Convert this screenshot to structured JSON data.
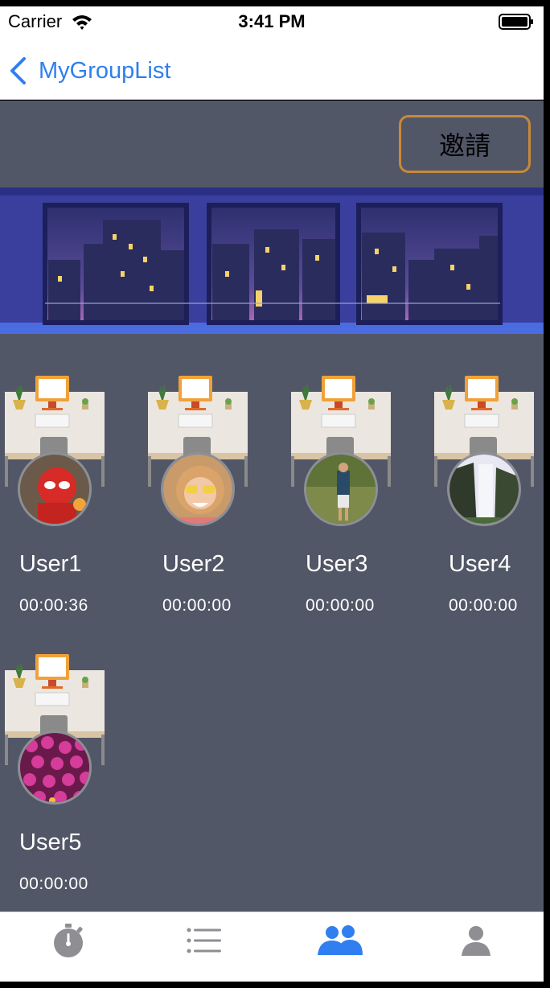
{
  "status_bar": {
    "carrier": "Carrier",
    "time": "3:41 PM"
  },
  "nav": {
    "back_label": "MyGroupList"
  },
  "invite_button": {
    "label": "邀請"
  },
  "users": [
    {
      "name": "User1",
      "time": "00:00:36",
      "avatar": "spiderman-lego-photo"
    },
    {
      "name": "User2",
      "time": "00:00:00",
      "avatar": "smiling-girl-photo"
    },
    {
      "name": "User3",
      "time": "00:00:00",
      "avatar": "man-on-trail-photo"
    },
    {
      "name": "User4",
      "time": "00:00:00",
      "avatar": "waterfall-photo"
    },
    {
      "name": "User5",
      "time": "00:00:00",
      "avatar": "pink-flowers-photo"
    }
  ],
  "tabs": [
    {
      "icon": "stopwatch-icon",
      "active": false
    },
    {
      "icon": "list-icon",
      "active": false
    },
    {
      "icon": "group-icon",
      "active": true
    },
    {
      "icon": "person-icon",
      "active": false
    }
  ],
  "colors": {
    "accent": "#2f7ff0",
    "background": "#525767",
    "invite_border": "#c8893a",
    "tab_inactive": "#8e8e93"
  }
}
